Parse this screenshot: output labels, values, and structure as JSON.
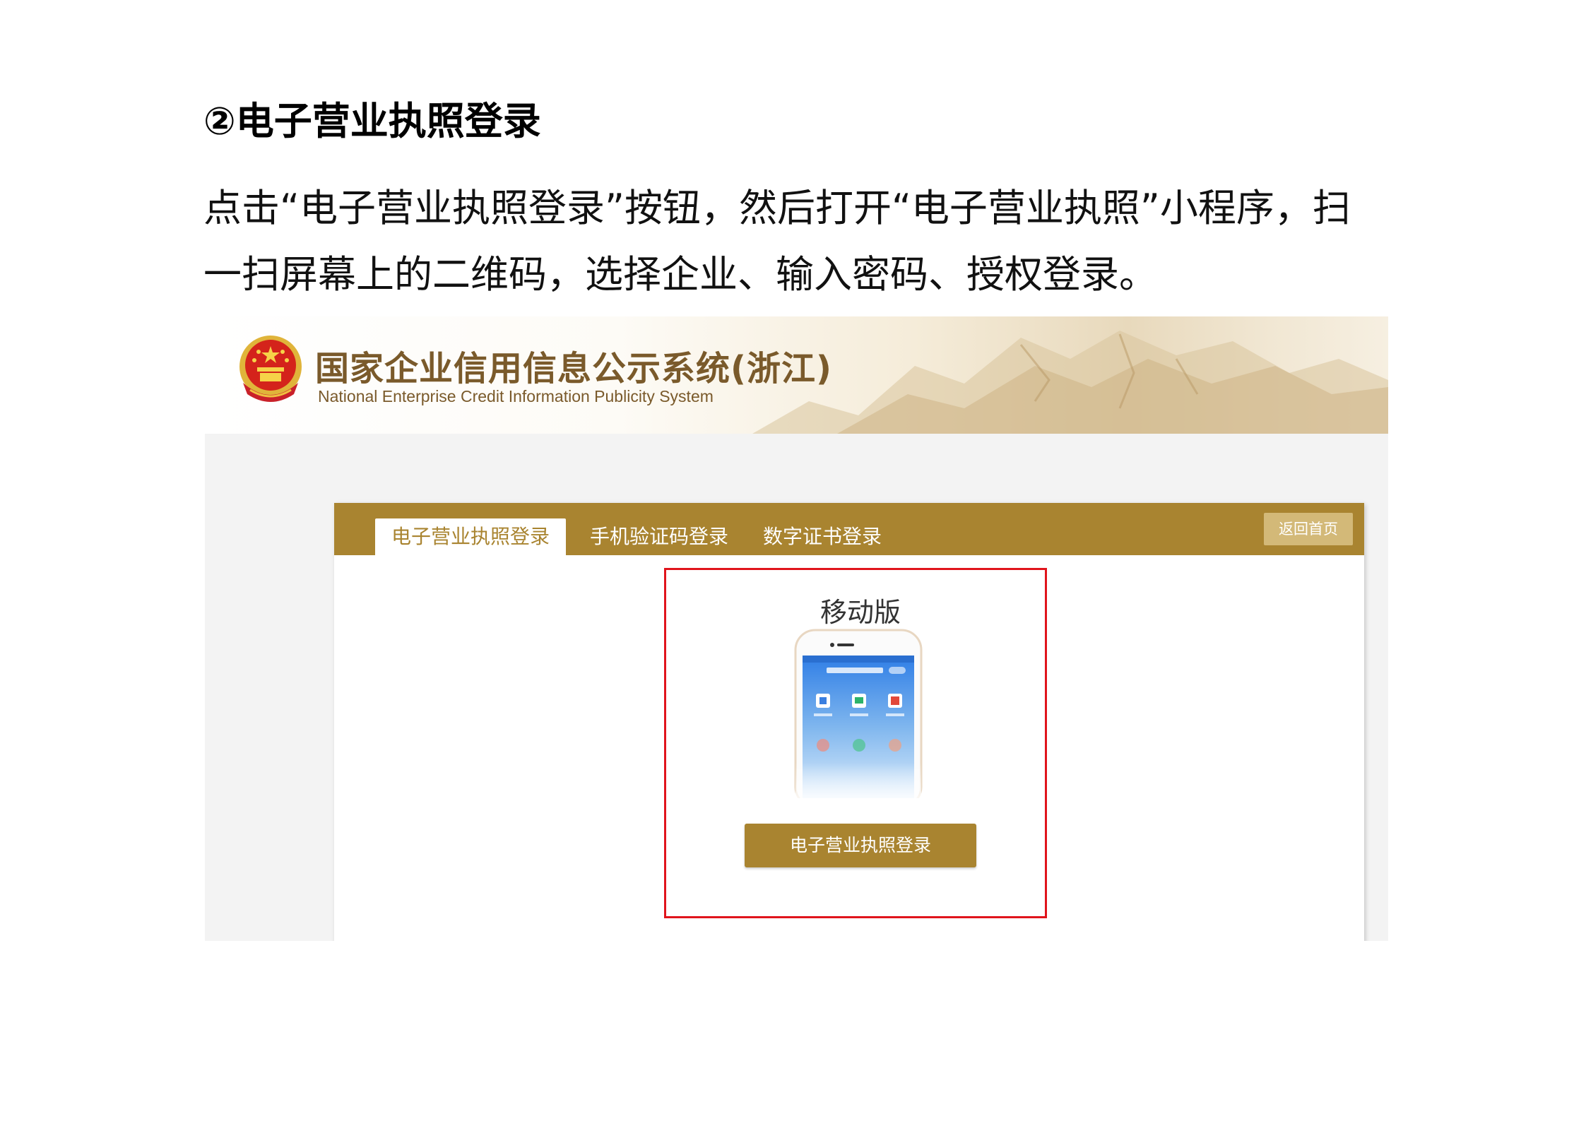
{
  "document": {
    "heading": "②电子营业执照登录",
    "paragraph_lines": [
      "点击“电子营业执照登录”按钮，然后打开“电子营业执照”小程序，扫",
      "一扫屏幕上的二维码，选择企业、输入密码、授权登录。"
    ]
  },
  "site": {
    "title": "国家企业信用信息公示系统(浙江)",
    "subtitle": "National Enterprise Credit Information Publicity System"
  },
  "tabs": [
    {
      "label": "电子营业执照登录",
      "active": true
    },
    {
      "label": "手机验证码登录",
      "active": false
    },
    {
      "label": "数字证书登录",
      "active": false
    }
  ],
  "back_button": "返回首页",
  "mobile_section": {
    "title": "移动版",
    "login_button": "电子营业执照登录"
  },
  "colors": {
    "brand_gold": "#a98430",
    "highlight_red": "#e0141c",
    "phone_blue": "#2f7ee6"
  }
}
